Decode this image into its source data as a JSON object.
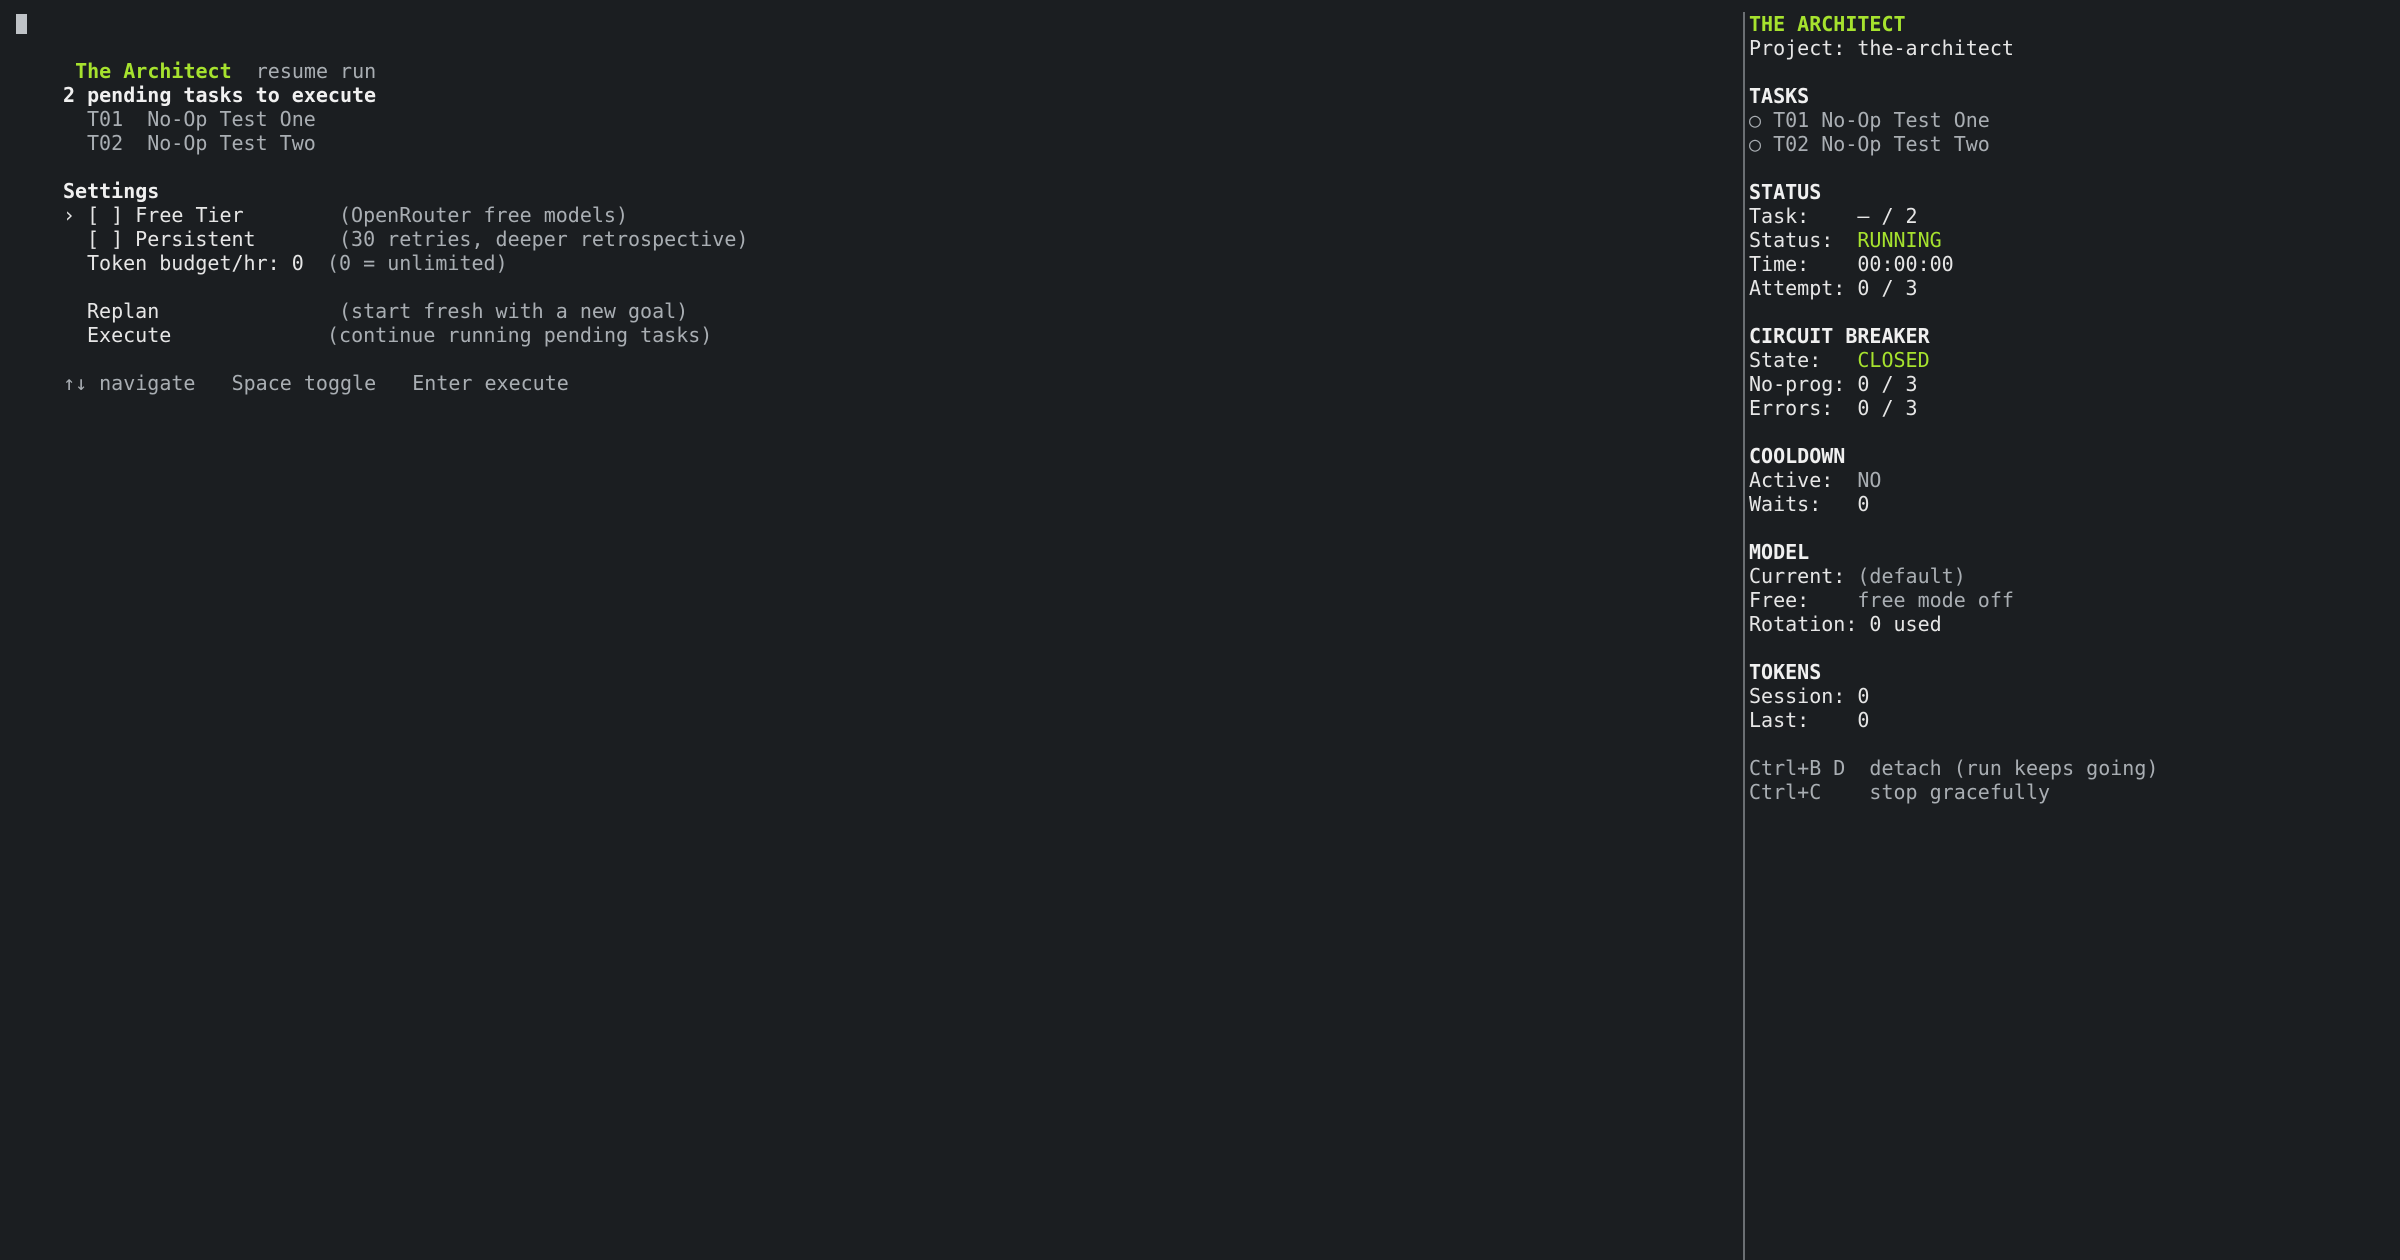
{
  "header": {
    "app_title": "The Architect",
    "mode": "resume run"
  },
  "pending": {
    "title": "2 pending tasks to execute",
    "tasks": [
      {
        "id": "T01",
        "name": "No-Op Test One"
      },
      {
        "id": "T02",
        "name": "No-Op Test Two"
      }
    ]
  },
  "settings": {
    "title": "Settings",
    "selector": "›",
    "items": [
      {
        "checkbox": "[ ]",
        "label": "Free Tier",
        "note": "(OpenRouter free models)"
      },
      {
        "checkbox": "[ ]",
        "label": "Persistent",
        "note": "(30 retries, deeper retrospective)"
      }
    ],
    "token_budget_label": "Token budget/hr: 0",
    "token_budget_note": "(0 = unlimited)"
  },
  "actions": [
    {
      "label": "Replan",
      "note": "(start fresh with a new goal)"
    },
    {
      "label": "Execute",
      "note": "(continue running pending tasks)"
    }
  ],
  "help": {
    "navigate_key": "↑↓",
    "navigate": "navigate",
    "toggle_key": "Space",
    "toggle": "toggle",
    "execute_key": "Enter",
    "execute": "execute"
  },
  "sidebar": {
    "title": "THE ARCHITECT",
    "project": "Project: the-architect",
    "tasks_heading": "TASKS",
    "tasks": [
      "○ T01 No-Op Test One",
      "○ T02 No-Op Test Two"
    ],
    "status_heading": "STATUS",
    "task_label": "Task:    ",
    "task_value": "– / 2",
    "status_label": "Status:  ",
    "status_value": "RUNNING",
    "time_label": "Time:    ",
    "time_value": "00:00:00",
    "attempt_label": "Attempt: ",
    "attempt_value": "0 / 3",
    "cb_heading": "CIRCUIT BREAKER",
    "state_label": "State:   ",
    "state_value": "CLOSED",
    "noprog_label": "No-prog: ",
    "noprog_value": "0 / 3",
    "errors_label": "Errors:  ",
    "errors_value": "0 / 3",
    "cooldown_heading": "COOLDOWN",
    "active_label": "Active:  ",
    "active_value": "NO",
    "waits_label": "Waits:   ",
    "waits_value": "0",
    "model_heading": "MODEL",
    "current_label": "Current: ",
    "current_value": "(default)",
    "free_label": "Free:    ",
    "free_value": "free mode off",
    "rotation_label": "Rotation: ",
    "rotation_value": "0 used",
    "tokens_heading": "TOKENS",
    "session_label": "Session: ",
    "session_value": "0",
    "last_label": "Last:    ",
    "last_value": "0",
    "shortcuts": [
      {
        "key": "Ctrl+B D",
        "desc": "detach (run keeps going)"
      },
      {
        "key": "Ctrl+C  ",
        "desc": "stop gracefully"
      }
    ]
  },
  "colors": {
    "background": "#1b1e21",
    "accent": "#a6e22e",
    "dim": "#a9aeb3"
  }
}
